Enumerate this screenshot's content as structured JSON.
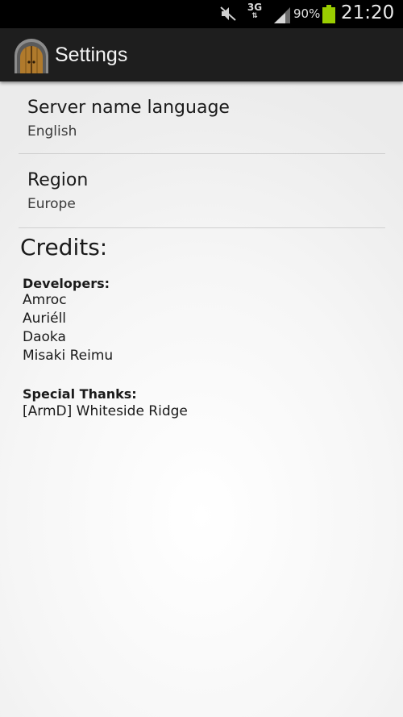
{
  "status_bar": {
    "network": "3G",
    "battery_percent": "90%",
    "time": "21:20",
    "icons": [
      "mute-icon",
      "data-activity-icon",
      "signal-icon",
      "battery-icon"
    ],
    "battery_color": "#9acd00"
  },
  "action_bar": {
    "title": "Settings",
    "icon": "door-app-icon"
  },
  "preferences": [
    {
      "title": "Server name language",
      "summary": "English"
    },
    {
      "title": "Region",
      "summary": "Europe"
    }
  ],
  "credits": {
    "heading": "Credits:",
    "developers_label": "Developers:",
    "developers": [
      "Amroc",
      "Auriéll",
      "Daoka",
      "Misaki Reimu"
    ],
    "special_thanks_label": "Special Thanks:",
    "special_thanks": [
      "[ArmD] Whiteside Ridge"
    ]
  }
}
